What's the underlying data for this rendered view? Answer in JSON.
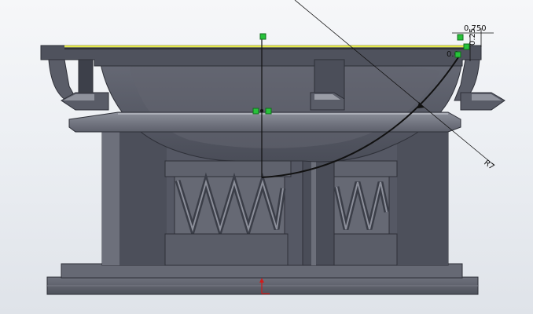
{
  "viewport": {
    "background_top": "#f6f7f9",
    "background_bottom": "#dfe3e9"
  },
  "model": {
    "body_color": "#5b5e6a",
    "dark_color": "#3d404a",
    "light_color": "#8a8d98",
    "edge_color": "#2a2c33"
  },
  "sketch": {
    "highlight_color": "#e4e84a",
    "sketch_line_color": "#111111",
    "relation_color": "#27c23a",
    "origin_color": "#d11a1a"
  },
  "dimensions": {
    "horizontal": "0.750",
    "vertical": "0.25",
    "small": "0.0",
    "radius": "R7"
  },
  "icons": {
    "sketch_point": "sketch-point-icon",
    "coincident_relation": "coincident-relation-icon",
    "origin": "origin-arrow-icon"
  }
}
